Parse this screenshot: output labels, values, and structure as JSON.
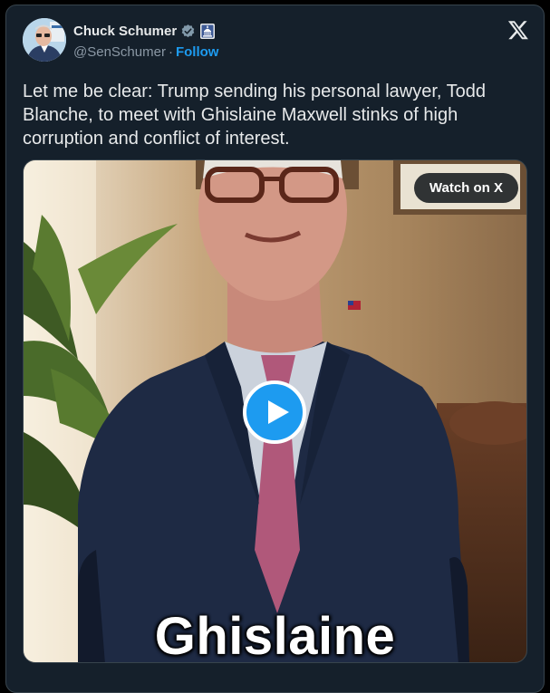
{
  "author": {
    "display_name": "Chuck Schumer",
    "handle": "@SenSchumer",
    "separator": "·",
    "follow_label": "Follow",
    "verified_badge_icon": "verified-checkmark-icon",
    "affiliation_badge_icon": "us-capitol-icon"
  },
  "tweet": {
    "text": "Let me be clear: Trump sending his personal lawyer, Todd Blanche, to meet with Ghislaine Maxwell stinks of high corruption and conflict of interest."
  },
  "media": {
    "watch_label": "Watch on X",
    "caption": "Ghislaine",
    "play_icon": "play-icon"
  },
  "colors": {
    "background": "#15202b",
    "accent": "#1d9bf0",
    "text_primary": "#e7e9ea",
    "text_secondary": "#8b98a5"
  }
}
